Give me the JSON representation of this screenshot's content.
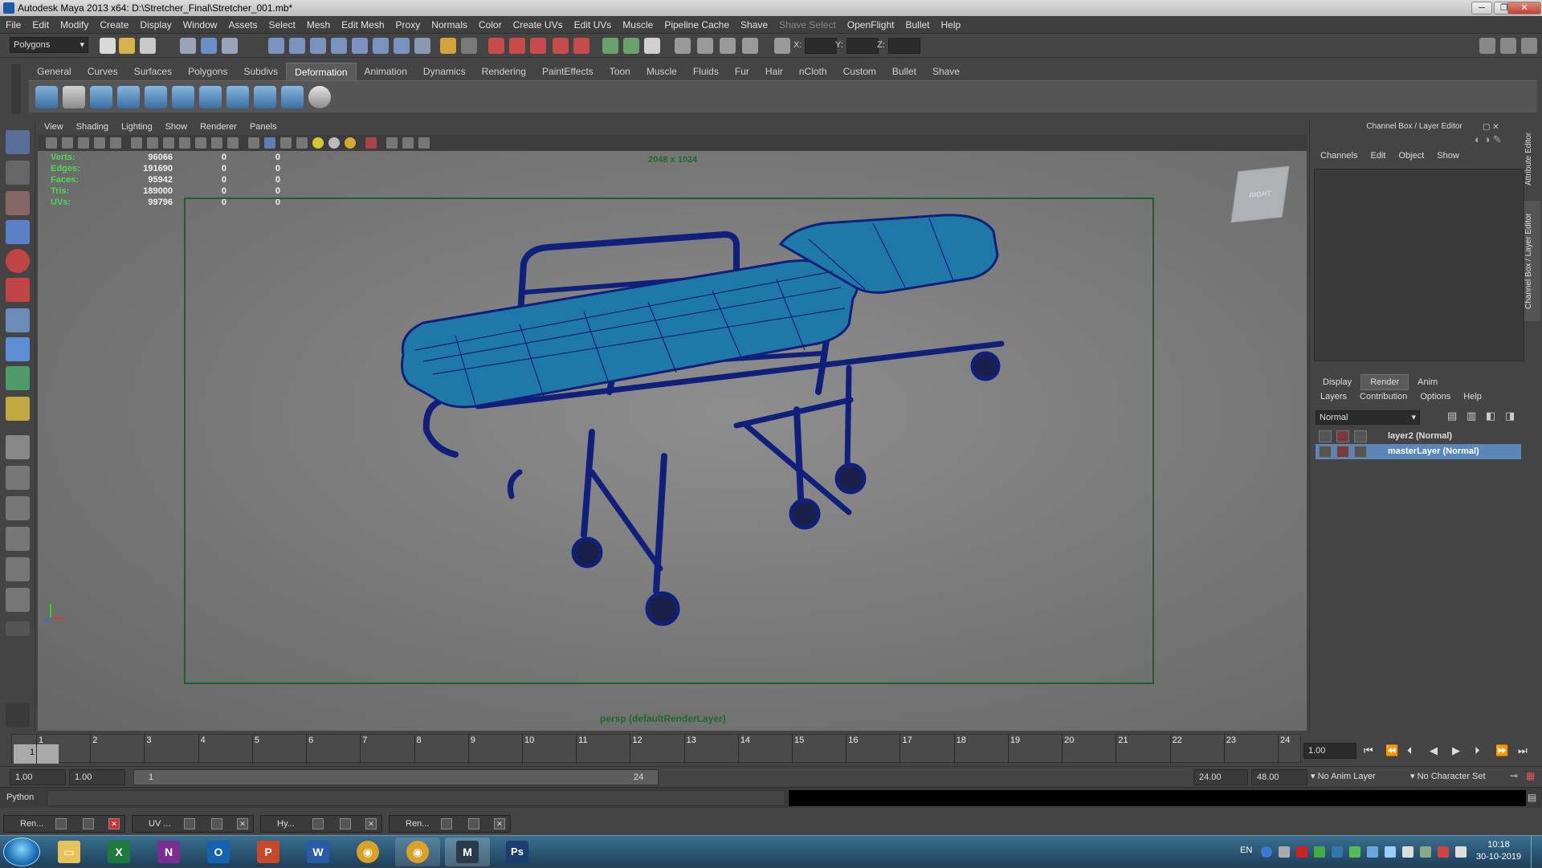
{
  "window": {
    "title": "Autodesk Maya 2013 x64: D:\\Stretcher_Final\\Stretcher_001.mb*",
    "minimize": "─",
    "restore": "❐",
    "close": "✕"
  },
  "menubar": [
    "File",
    "Edit",
    "Modify",
    "Create",
    "Display",
    "Window",
    "Assets",
    "Select",
    "Mesh",
    "Edit Mesh",
    "Proxy",
    "Normals",
    "Color",
    "Create UVs",
    "Edit UVs",
    "Muscle",
    "Pipeline Cache",
    "Shave",
    "Shave Select",
    "OpenFlight",
    "Bullet",
    "Help"
  ],
  "statusline": {
    "menuset": "Polygons",
    "x_label": "X:",
    "y_label": "Y:",
    "z_label": "Z:"
  },
  "shelf": {
    "tabs": [
      "General",
      "Curves",
      "Surfaces",
      "Polygons",
      "Subdivs",
      "Deformation",
      "Animation",
      "Dynamics",
      "Rendering",
      "PaintEffects",
      "Toon",
      "Muscle",
      "Fluids",
      "Fur",
      "Hair",
      "nCloth",
      "Custom",
      "Bullet",
      "Shave"
    ],
    "active_tab": "Deformation"
  },
  "viewport": {
    "menu": [
      "View",
      "Shading",
      "Lighting",
      "Show",
      "Renderer",
      "Panels"
    ],
    "hud": [
      {
        "label": "Verts:",
        "v1": "96066",
        "v2": "0",
        "v3": "0"
      },
      {
        "label": "Edges:",
        "v1": "191690",
        "v2": "0",
        "v3": "0"
      },
      {
        "label": "Faces:",
        "v1": "95942",
        "v2": "0",
        "v3": "0"
      },
      {
        "label": "Tris:",
        "v1": "189000",
        "v2": "0",
        "v3": "0"
      },
      {
        "label": "UVs:",
        "v1": "99796",
        "v2": "0",
        "v3": "0"
      }
    ],
    "resolution": "2048 x 1024",
    "camera_label": "persp (defaultRenderLayer)",
    "viewcube_face": "RIGHT",
    "mesh_color": "#1f79a8",
    "wire_color": "#10207a"
  },
  "channelbox": {
    "title": "Channel Box / Layer Editor",
    "menu": [
      "Channels",
      "Edit",
      "Object",
      "Show"
    ]
  },
  "layer_editor": {
    "tabs": [
      "Display",
      "Render",
      "Anim"
    ],
    "active_tab": "Render",
    "menu": [
      "Layers",
      "Contribution",
      "Options",
      "Help"
    ],
    "blend_mode": "Normal",
    "layers": [
      {
        "name": "layer2 (Normal)",
        "selected": false
      },
      {
        "name": "masterLayer (Normal)",
        "selected": true
      }
    ]
  },
  "side_tabs": [
    "Attribute Editor",
    "Channel Box / Layer Editor"
  ],
  "timeslider": {
    "frames": [
      "1",
      "2",
      "3",
      "4",
      "5",
      "6",
      "7",
      "8",
      "9",
      "10",
      "11",
      "12",
      "13",
      "14",
      "15",
      "16",
      "17",
      "18",
      "19",
      "20",
      "21",
      "22",
      "23",
      "24"
    ],
    "current_marker": "1",
    "current_frame": "1.00"
  },
  "playback": {
    "icons": [
      "⏮",
      "⏪",
      "⏴",
      "◀",
      "▶",
      "⏵",
      "⏩",
      "⏭"
    ]
  },
  "rangeslider": {
    "start": "1.00",
    "playback_start": "1.00",
    "bar_start": "1",
    "bar_end": "24",
    "playback_end": "24.00",
    "end": "48.00",
    "anim_layer": "No Anim Layer",
    "char_set": "No Character Set"
  },
  "cmdline": {
    "lang": "Python"
  },
  "minimized_windows": [
    {
      "title": "Ren..."
    },
    {
      "title": "UV ..."
    },
    {
      "title": "Hy..."
    },
    {
      "title": "Ren..."
    }
  ],
  "taskbar": {
    "apps": [
      {
        "name": "explorer",
        "glyph": "▭",
        "color": "#e7c15a"
      },
      {
        "name": "excel",
        "glyph": "X",
        "color": "#1e7a3c"
      },
      {
        "name": "onenote",
        "glyph": "N",
        "color": "#7a2e92"
      },
      {
        "name": "outlook",
        "glyph": "O",
        "color": "#1563b0"
      },
      {
        "name": "powerpoint",
        "glyph": "P",
        "color": "#c8482a"
      },
      {
        "name": "word",
        "glyph": "W",
        "color": "#2a5aa8"
      },
      {
        "name": "chrome",
        "glyph": "◉",
        "color": "#d9a227"
      },
      {
        "name": "chrome-2",
        "glyph": "◉",
        "color": "#d9a227"
      },
      {
        "name": "maya",
        "glyph": "M",
        "color": "#2a3a48"
      },
      {
        "name": "photoshop",
        "glyph": "Ps",
        "color": "#1b3e6e"
      }
    ],
    "lang": "EN",
    "time": "10:18",
    "date": "30-10-2019"
  }
}
